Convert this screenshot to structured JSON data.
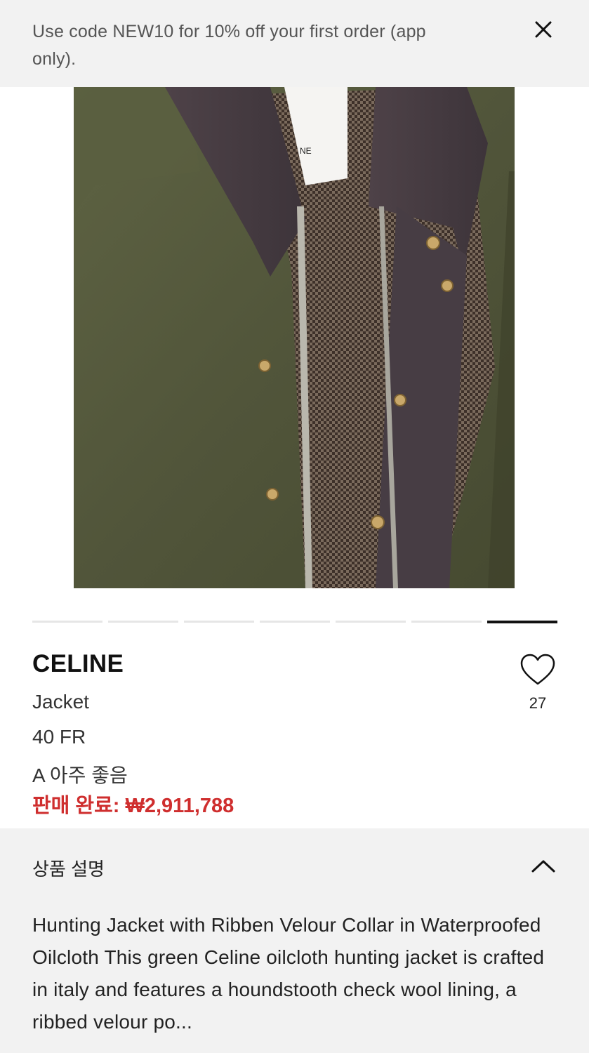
{
  "promo": {
    "message": "Use code NEW10 for 10% off your first order (app only).",
    "close_icon": "close-icon"
  },
  "photo": {
    "alt": "",
    "colors": {
      "jacket": "#55583a",
      "collar": "#4a3f44",
      "lining": "#6b5a4c",
      "background": "#f0efed"
    }
  },
  "carousel": {
    "total": 7,
    "active_index": 6
  },
  "product": {
    "brand": "CELINE",
    "name": "Jacket",
    "size": "40 FR",
    "condition": "A 아주 좋음",
    "sold_price": "판매 완료: ₩2,911,788",
    "sold_color": "#cf2e2e"
  },
  "wishlist": {
    "icon": "heart-outline-icon",
    "count": "27"
  },
  "description": {
    "title": "상품 설명",
    "toggle_icon": "chevron-up-icon",
    "text": "Hunting Jacket with Ribben Velour Collar in Waterproofed Oilcloth This green Celine oilcloth hunting jacket is crafted in italy and features a houndstooth check wool lining, a ribbed velour po..."
  }
}
